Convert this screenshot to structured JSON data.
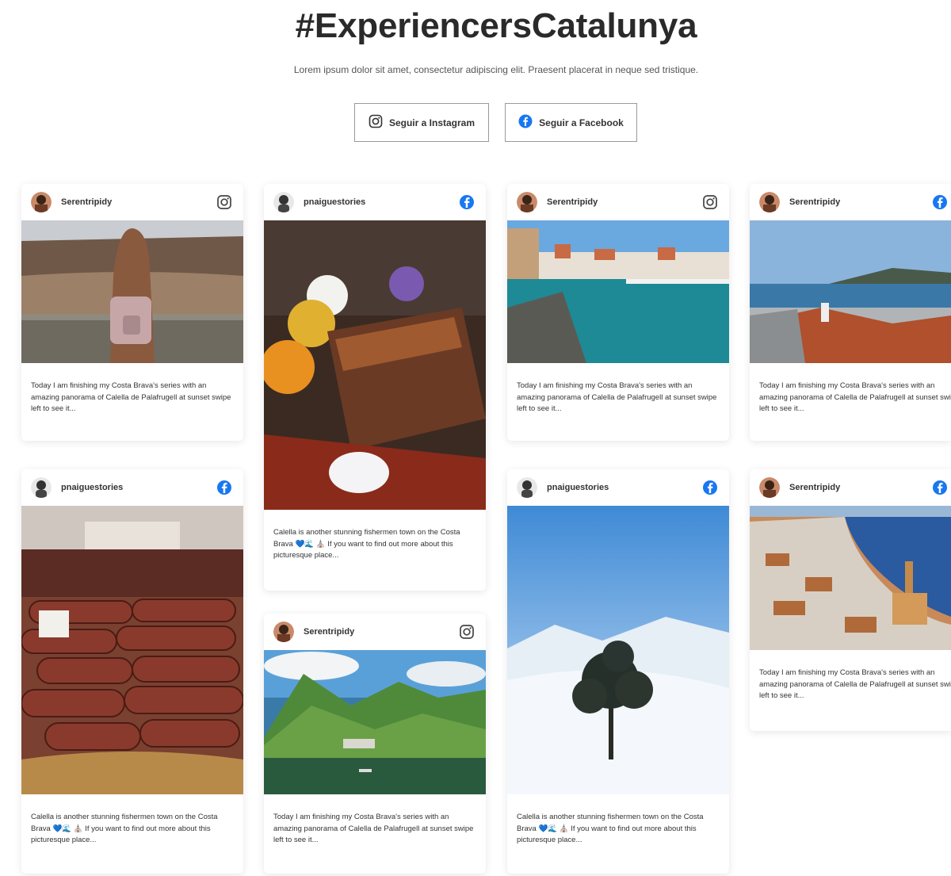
{
  "header": {
    "title": "#ExperiencersCatalunya",
    "subtitle": "Lorem ipsum dolor sit amet, consectetur adipiscing elit. Praesent placerat in neque sed tristique."
  },
  "follow": {
    "instagram_label": "Seguir a Instagram",
    "facebook_label": "Seguir a Facebook"
  },
  "posts": [
    {
      "user": "Serentripidy",
      "network": "instagram",
      "caption": "Today I am finishing my Costa Brava's series with an amazing panorama of Calella de Palafrugell at sunset swipe left to see it...",
      "image": "girl-overlook-photo"
    },
    {
      "user": "Serentripidy",
      "network": "instagram",
      "caption": "Today I am finishing my Costa Brava's series with an amazing panorama of Calella de Palafrugell at sunset swipe left to see it...",
      "image": "harbor-town-photo"
    },
    {
      "user": "Serentripidy",
      "network": "facebook",
      "caption": "Today I am finishing my Costa Brava's series with an amazing panorama of Calella de Palafrugell at sunset swipe left to see it...",
      "image": "bay-rooftops-photo"
    },
    {
      "user": "pnaiguestories",
      "network": "facebook",
      "caption": "Calella is another stunning fishermen town on the Costa Brava 💙🌊 ⛪ If you want to find out more about this picturesque place...",
      "image": "grilled-meat-photo"
    },
    {
      "user": "pnaiguestories",
      "network": "facebook",
      "caption": "Calella is another stunning fishermen town on the Costa Brava 💙🌊 ⛪ If you want to find out more about this picturesque place...",
      "image": "sausages-market-photo"
    },
    {
      "user": "Serentripidy",
      "network": "instagram",
      "caption": "Today I am finishing my Costa Brava's series with an amazing panorama of Calella de Palafrugell at sunset swipe left to see it...",
      "image": "mountain-lake-photo"
    },
    {
      "user": "pnaiguestories",
      "network": "facebook",
      "caption": "Calella is another stunning fishermen town on the Costa Brava 💙🌊 ⛪ If you want to find out more about this picturesque place...",
      "image": "snowy-tree-photo"
    },
    {
      "user": "Serentripidy",
      "network": "facebook",
      "caption": "Today I am finishing my Costa Brava's series with an amazing panorama of Calella de Palafrugell at sunset swipe left to see it...",
      "image": "coastal-town-photo"
    }
  ],
  "colors": {
    "facebook_blue": "#1877f2",
    "card_shadow": "#e6e6e6"
  }
}
